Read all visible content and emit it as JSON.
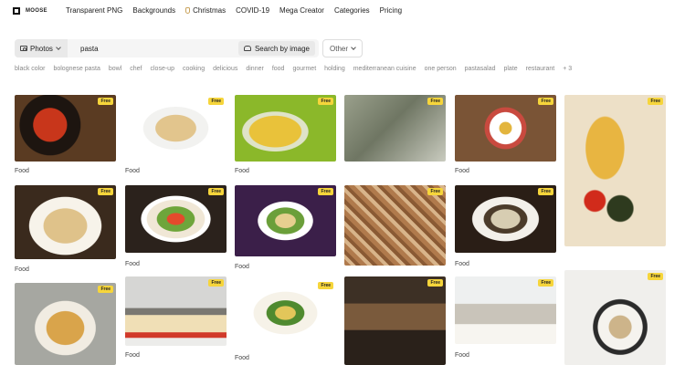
{
  "brand": {
    "name": "MOOSE"
  },
  "nav": {
    "links": [
      "Transparent PNG",
      "Backgrounds",
      "Christmas",
      "COVID-19",
      "Mega Creator",
      "Categories",
      "Pricing"
    ]
  },
  "search": {
    "type_label": "Photos",
    "query": "pasta",
    "by_image_label": "Search by image",
    "other_label": "Other"
  },
  "tags": [
    "black color",
    "bolognese pasta",
    "bowl",
    "chef",
    "close-up",
    "cooking",
    "delicious",
    "dinner",
    "food",
    "gourmet",
    "holding",
    "mediterranean cuisine",
    "one person",
    "pastasalad",
    "plate",
    "restaurant",
    "+ 3"
  ],
  "badge_label": "Free",
  "results": [
    {
      "caption": "Food"
    },
    {
      "caption": "Food"
    },
    {
      "caption": "Food"
    },
    {
      "caption": ""
    },
    {
      "caption": "Food"
    },
    {
      "caption": ""
    },
    {
      "caption": "Food"
    },
    {
      "caption": "Food"
    },
    {
      "caption": "Food"
    },
    {
      "caption": ""
    },
    {
      "caption": "Food"
    },
    {
      "caption": "Food"
    },
    {
      "caption": ""
    },
    {
      "caption": "Food"
    },
    {
      "caption": "Food"
    },
    {
      "caption": ""
    },
    {
      "caption": "Food"
    },
    {
      "caption": ""
    }
  ]
}
